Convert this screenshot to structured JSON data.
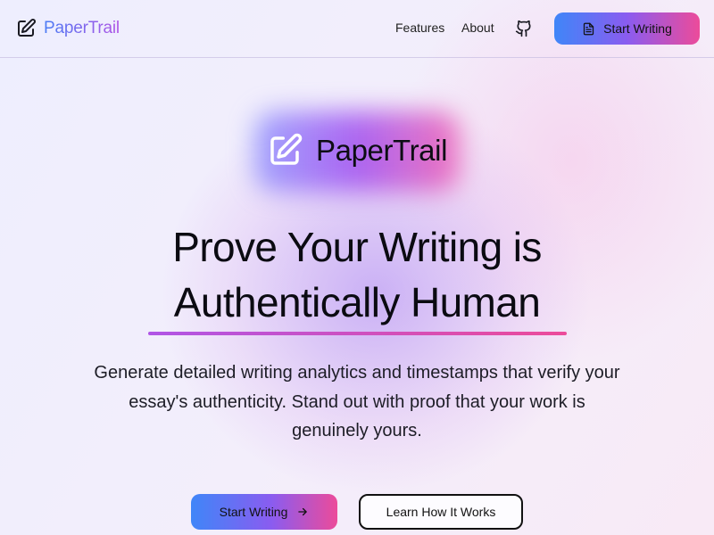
{
  "nav": {
    "brand": "PaperTrail",
    "links": [
      "Features",
      "About"
    ],
    "github_icon": "github-icon",
    "cta_label": "Start Writing",
    "cta_icon": "document-icon"
  },
  "hero": {
    "brand": "PaperTrail",
    "logo_icon": "pencil-square-icon",
    "headline_line1": "Prove Your Writing is",
    "headline_line2": "Authentically Human",
    "subtext": "Generate detailed writing analytics and timestamps that verify your essay's authenticity. Stand out with proof that your work is genuinely yours.",
    "primary_cta": "Start Writing",
    "primary_cta_icon": "arrow-right-icon",
    "secondary_cta": "Learn How It Works"
  },
  "colors": {
    "gradient_start": "#3f86f8",
    "gradient_mid": "#8a5cf0",
    "gradient_end": "#ec4b9a",
    "brand_text_start": "#4a7cf5",
    "brand_text_end": "#b055e6"
  }
}
